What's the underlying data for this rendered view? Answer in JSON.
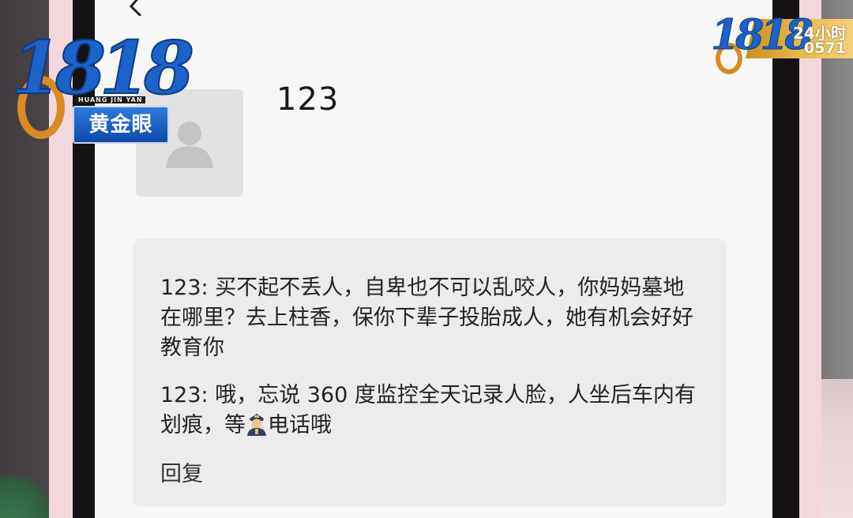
{
  "contact": {
    "name": "123",
    "avatar_icon": "person-placeholder-icon"
  },
  "messages": [
    {
      "text": "123: 买不起不丢人，自卑也不可以乱咬人，你妈妈墓地在哪里？去上柱香，保你下辈子投胎成人，她有机会好好教育你"
    },
    {
      "text_before": "123: 哦，忘说 360 度监控全天记录人脸，人坐后车内有划痕，等",
      "emoji": "police-officer-icon",
      "text_after": "电话哦"
    }
  ],
  "reply_label": "回复",
  "nav": {
    "back_icon": "chevron-left-icon"
  },
  "tv_overlay": {
    "left_logo": {
      "digits": "1818",
      "romanization": "HUANG JIN YAN",
      "badge": "黄金眼"
    },
    "right_logo": {
      "digits": "1818"
    },
    "ticker": {
      "line1": "24小时",
      "line2": "0571"
    }
  },
  "colors": {
    "screen_bg": "#f7f7f7",
    "card_bg": "#ececec",
    "text": "#222222",
    "logo_blue": "#1b62c9",
    "logo_orange": "#d98a22",
    "ticker_gold": "#e8b84a"
  }
}
